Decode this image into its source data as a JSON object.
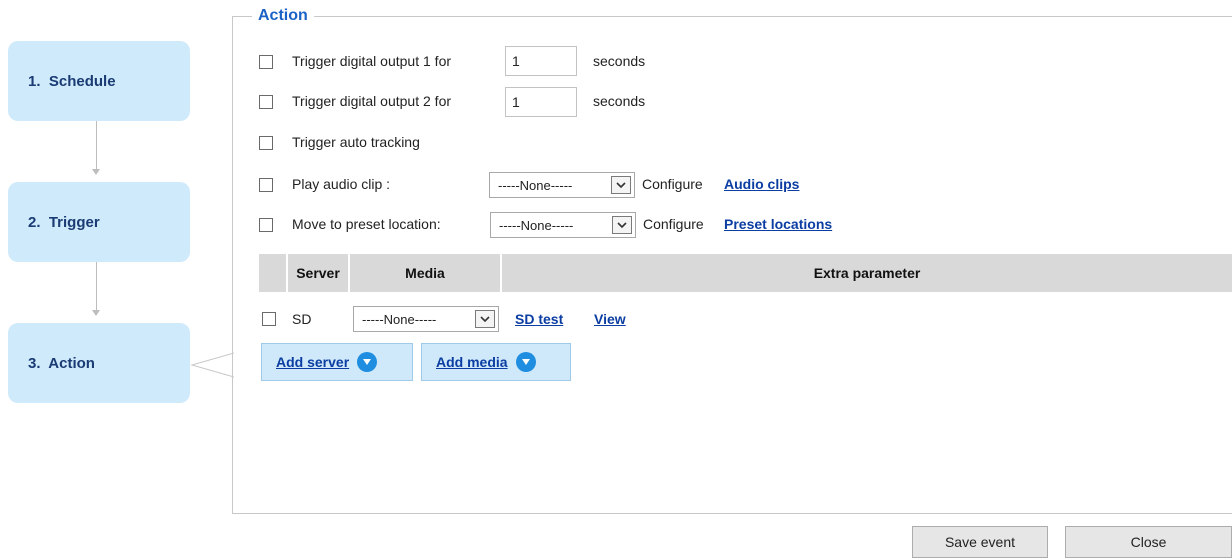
{
  "steps": [
    {
      "label": "1.  Schedule"
    },
    {
      "label": "2.  Trigger"
    },
    {
      "label": "3.  Action"
    }
  ],
  "section": {
    "legend": "Action"
  },
  "actions": {
    "do1": {
      "label": "Trigger digital output 1 for",
      "value": "1",
      "unit": "seconds"
    },
    "do2": {
      "label": "Trigger digital output 2 for",
      "value": "1",
      "unit": "seconds"
    },
    "auto_tracking": {
      "label": "Trigger auto tracking"
    },
    "audio": {
      "label": "Play audio clip :",
      "selected": "-----None-----",
      "configure": "Configure",
      "link": "Audio clips"
    },
    "preset": {
      "label": "Move to preset location:",
      "selected": "-----None-----",
      "configure": "Configure",
      "link": "Preset locations"
    }
  },
  "table": {
    "headers": {
      "server": "Server",
      "media": "Media",
      "extra": "Extra parameter"
    },
    "row": {
      "server": "SD",
      "media": "-----None-----",
      "test_link": "SD test",
      "view_link": "View"
    }
  },
  "buttons": {
    "add_server": "Add server",
    "add_media": "Add media",
    "save": "Save event",
    "close": "Close"
  },
  "colors": {
    "accent": "#1a62c6",
    "step_bg": "#cfeafb",
    "link": "#0b3da2",
    "add_icon": "#1f8ee0"
  }
}
